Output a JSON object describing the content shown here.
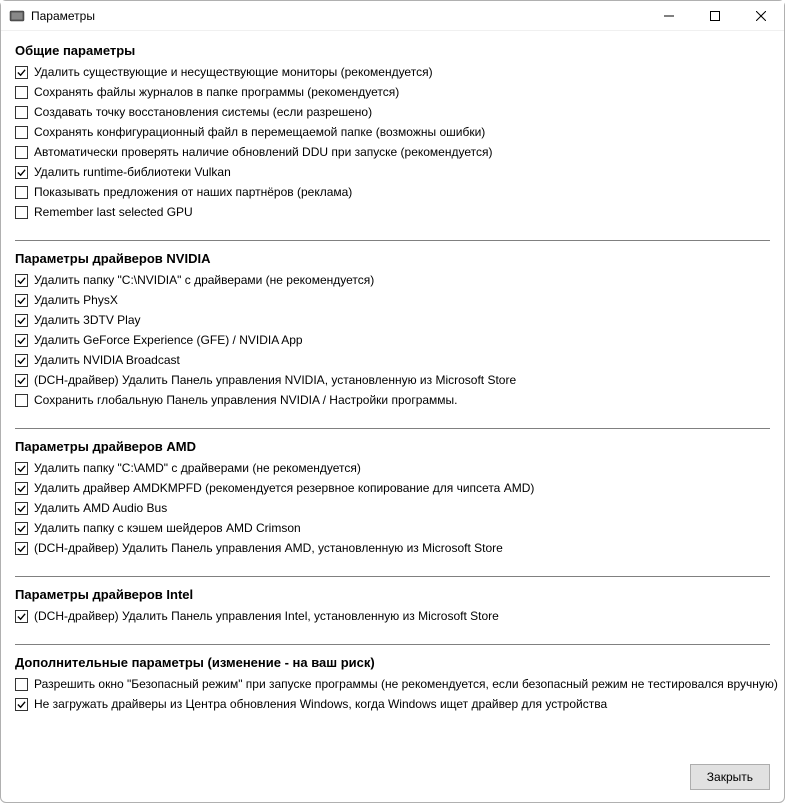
{
  "window": {
    "title": "Параметры"
  },
  "sections": {
    "general": {
      "title": "Общие параметры",
      "options": [
        {
          "label": "Удалить существующие и несуществующие мониторы (рекомендуется)",
          "checked": true
        },
        {
          "label": "Сохранять файлы журналов в папке программы (рекомендуется)",
          "checked": false
        },
        {
          "label": "Создавать точку восстановления системы (если разрешено)",
          "checked": false
        },
        {
          "label": "Сохранять конфигурационный файл в перемещаемой папке (возможны ошибки)",
          "checked": false
        },
        {
          "label": "Автоматически проверять наличие обновлений DDU при запуске (рекомендуется)",
          "checked": false
        },
        {
          "label": "Удалить runtime-библиотеки Vulkan",
          "checked": true
        },
        {
          "label": "Показывать предложения от наших партнёров (реклама)",
          "checked": false
        },
        {
          "label": "Remember last selected GPU",
          "checked": false
        }
      ]
    },
    "nvidia": {
      "title": "Параметры драйверов NVIDIA",
      "options": [
        {
          "label": "Удалить папку \"C:\\NVIDIA\" с драйверами (не рекомендуется)",
          "checked": true
        },
        {
          "label": "Удалить PhysX",
          "checked": true
        },
        {
          "label": "Удалить 3DTV Play",
          "checked": true
        },
        {
          "label": "Удалить GeForce Experience (GFE) / NVIDIA App",
          "checked": true
        },
        {
          "label": "Удалить NVIDIA Broadcast",
          "checked": true
        },
        {
          "label": "(DCH-драйвер) Удалить Панель управления NVIDIA, установленную из Microsoft Store",
          "checked": true
        },
        {
          "label": "Сохранить глобальную Панель управления NVIDIA / Настройки программы.",
          "checked": false
        }
      ]
    },
    "amd": {
      "title": "Параметры драйверов AMD",
      "options": [
        {
          "label": "Удалить папку \"C:\\AMD\" с драйверами (не рекомендуется)",
          "checked": true
        },
        {
          "label": "Удалить драйвер AMDKMPFD (рекомендуется резервное копирование для чипсета AMD)",
          "checked": true
        },
        {
          "label": "Удалить AMD Audio Bus",
          "checked": true
        },
        {
          "label": "Удалить папку с кэшем шейдеров AMD Crimson",
          "checked": true
        },
        {
          "label": "(DCH-драйвер) Удалить Панель управления AMD, установленную из Microsoft Store",
          "checked": true
        }
      ]
    },
    "intel": {
      "title": "Параметры драйверов Intel",
      "options": [
        {
          "label": "(DCH-драйвер) Удалить Панель управления Intel, установленную из Microsoft Store",
          "checked": true
        }
      ]
    },
    "advanced": {
      "title": "Дополнительные параметры (изменение - на ваш риск)",
      "options": [
        {
          "label": "Разрешить окно \"Безопасный режим\" при запуске программы (не рекомендуется, если безопасный режим не тестировался вручную)",
          "checked": false
        },
        {
          "label": "Не загружать драйверы из Центра обновления Windows, когда Windows ищет драйвер для устройства",
          "checked": true
        }
      ]
    }
  },
  "footer": {
    "close_label": "Закрыть"
  }
}
